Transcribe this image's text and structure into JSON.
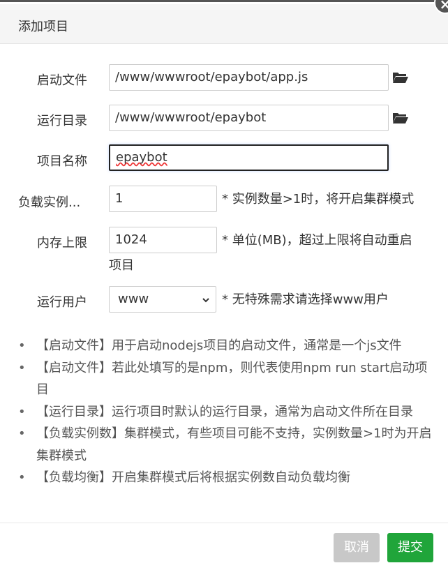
{
  "dialog": {
    "title": "添加项目",
    "close_icon": "close-icon"
  },
  "form": {
    "start_file": {
      "label": "启动文件",
      "value": "/www/wwwroot/epaybot/app.js"
    },
    "run_dir": {
      "label": "运行目录",
      "value": "/www/wwwroot/epaybot"
    },
    "project_name": {
      "label": "项目名称",
      "value": "epaybot"
    },
    "instances": {
      "label": "负载实例...",
      "value": "1",
      "hint": "* 实例数量>1时，将开启集群模式"
    },
    "memory": {
      "label": "内存上限",
      "value": "1024",
      "hint_line1": "* 单位(MB)，超过上限将自动重启",
      "hint_line2": "项目"
    },
    "run_user": {
      "label": "运行用户",
      "value": "www",
      "hint": "* 无特殊需求请选择www用户"
    }
  },
  "notes": [
    "【启动文件】用于启动nodejs项目的启动文件，通常是一个js文件",
    "【启动文件】若此处填写的是npm，则代表使用npm run start启动项目",
    "【运行目录】运行项目时默认的运行目录，通常为启动文件所在目录",
    "【负载实例数】集群模式，有些项目可能不支持，实例数量>1时为开启集群模式",
    "【负载均衡】开启集群模式后将根据实例数自动负载均衡"
  ],
  "footer": {
    "cancel_label": "取消",
    "submit_label": "提交"
  },
  "colors": {
    "submit": "#20a53a",
    "cancel": "#c8c8c8",
    "header_bg": "#f5f5f5"
  }
}
